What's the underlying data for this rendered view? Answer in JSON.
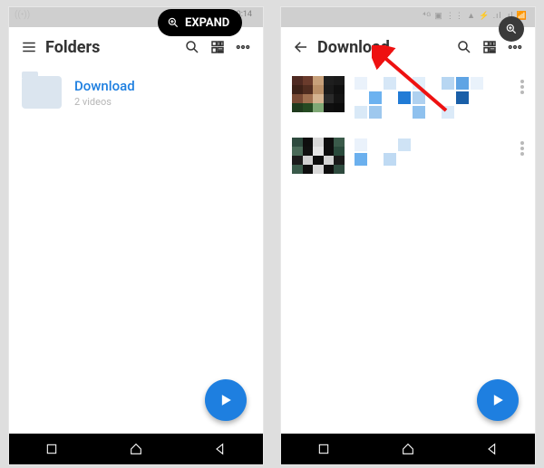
{
  "overlay": {
    "expand_label": "EXPAND"
  },
  "left": {
    "status": {
      "signal_icon": "((•))",
      "time": "0:14"
    },
    "appbar": {
      "title": "Folders"
    },
    "folder": {
      "name": "Download",
      "subtitle": "2 videos"
    }
  },
  "right": {
    "status": {
      "icons": "⁴ᴳ ▣ ⋮⋮ ▲ ⚡ .ıl .ıl 📶"
    },
    "appbar": {
      "title": "Download"
    }
  }
}
